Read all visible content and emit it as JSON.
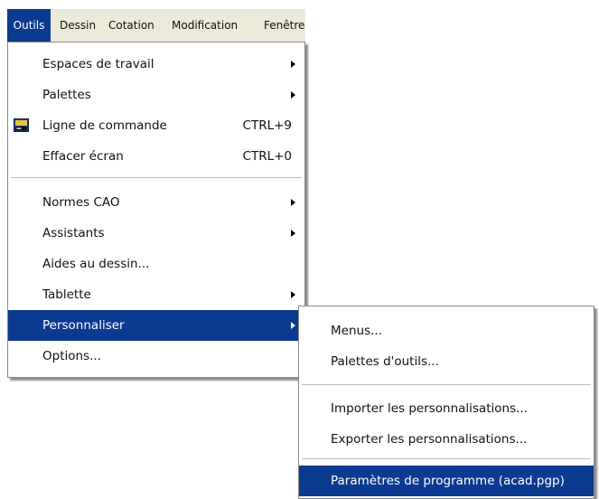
{
  "menubar": {
    "items": [
      {
        "label": "Outils",
        "active": true
      },
      {
        "label": "Dessin",
        "active": false
      },
      {
        "label": "Cotation",
        "active": false
      },
      {
        "label": "Modification",
        "active": false
      },
      {
        "label": "Fenêtre",
        "active": false
      }
    ]
  },
  "outils_menu": {
    "items": [
      {
        "label": "Espaces de travail",
        "submenu": true
      },
      {
        "label": "Palettes",
        "submenu": true
      },
      {
        "label": "Ligne de commande",
        "shortcut": "CTRL+9",
        "icon": "command-line-icon"
      },
      {
        "label": "Effacer écran",
        "shortcut": "CTRL+0"
      },
      {
        "label": "Normes CAO",
        "submenu": true
      },
      {
        "label": "Assistants",
        "submenu": true
      },
      {
        "label": "Aides au dessin..."
      },
      {
        "label": "Tablette",
        "submenu": true
      },
      {
        "label": "Personnaliser",
        "submenu": true,
        "highlighted": true
      },
      {
        "label": "Options..."
      }
    ]
  },
  "personnaliser_submenu": {
    "items": [
      {
        "label": "Menus..."
      },
      {
        "label": "Palettes d'outils..."
      },
      {
        "label": "Importer les personnalisations..."
      },
      {
        "label": "Exporter les personnalisations..."
      },
      {
        "label": "Paramètres de programme (acad.pgp)",
        "highlighted": true
      }
    ]
  },
  "colors": {
    "highlight": "#0b3b91",
    "menubar_bg": "#ece9d8"
  }
}
